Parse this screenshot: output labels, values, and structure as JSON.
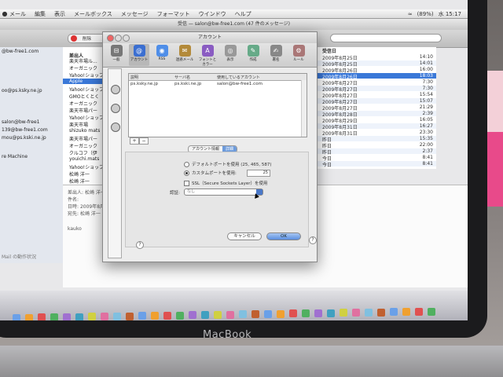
{
  "device": {
    "brand_label": "MacBook"
  },
  "menubar": {
    "items": [
      "メール",
      "編集",
      "表示",
      "メールボックス",
      "メッセージ",
      "フォーマット",
      "ウインドウ",
      "ヘルプ"
    ],
    "battery": "(89%)",
    "clock": "水 15:17"
  },
  "main_window": {
    "title": "受信 — salon@bw-free1.com (47 件のメッセージ)",
    "toolbar": {
      "delete_label": "削除",
      "search_label": "検索"
    }
  },
  "sidebar": {
    "items": [
      "@bw-free1.com",
      "oo@ps.ksky.ne.jp",
      "",
      "",
      "salon@bw-free1",
      "139@bw-free1.com",
      "mou@ps.kski.ne.jp",
      "",
      "re Machine"
    ],
    "footer": "Mail の動作状況"
  },
  "message_list": {
    "header": "差出人",
    "rows": [
      "楽天市場ル...",
      "オーガニック",
      "Yahoo!ショップ",
      "Apple",
      "Yahoo!ショップ",
      "GMOとくとく",
      "オーガニック",
      "楽天市場パー",
      "Yahoo!ショップ",
      "楽天市場",
      "shizuko mats",
      "楽天市場パー",
      "オーガニック",
      "クルコフ（伊",
      "youichi.mats",
      "Yahoo!ショップ",
      "松崎 洋一",
      "松崎 洋一"
    ],
    "selected_index": 3
  },
  "date_list": {
    "header": "受信日",
    "search_label": "検索",
    "rows": [
      {
        "date": "2009年8月25日",
        "time": "14:10"
      },
      {
        "date": "2009年8月25日",
        "time": "14:01"
      },
      {
        "date": "2009年8月26日",
        "time": "16:00"
      },
      {
        "date": "2009年8月26日",
        "time": "18:03"
      },
      {
        "date": "2009年8月27日",
        "time": "7:30"
      },
      {
        "date": "2009年8月27日",
        "time": "7:30"
      },
      {
        "date": "2009年8月27日",
        "time": "15:54"
      },
      {
        "date": "2009年8月27日",
        "time": "15:07"
      },
      {
        "date": "2009年8月27日",
        "time": "21:29"
      },
      {
        "date": "2009年8月28日",
        "time": "2:39"
      },
      {
        "date": "2009年8月29日",
        "time": "16:05"
      },
      {
        "date": "2009年8月31日",
        "time": "16:27"
      },
      {
        "date": "2009年8月31日",
        "time": "23:30"
      },
      {
        "date": "昨日",
        "time": "15:35"
      },
      {
        "date": "昨日",
        "time": "22:00"
      },
      {
        "date": "昨日",
        "time": "2:37"
      },
      {
        "date": "今日",
        "time": "8:41"
      },
      {
        "date": "今日",
        "time": "8:41"
      }
    ],
    "selected_index": 3
  },
  "preview": {
    "from_label": "差出人:",
    "from_value": "松崎 洋一",
    "subject_label": "件名:",
    "date_label": "日時:",
    "date_value": "2009年8月2",
    "to_label": "宛先:",
    "to_value": "松崎 洋一",
    "body": "kauko"
  },
  "accounts_dialog": {
    "title": "アカウント",
    "toolbar": [
      {
        "label": "一般",
        "icon": "switch-icon"
      },
      {
        "label": "アカウント",
        "icon": "at-sign-icon"
      },
      {
        "label": "RSS",
        "icon": "rss-icon"
      },
      {
        "label": "迷惑メール",
        "icon": "junk-mail-icon"
      },
      {
        "label": "フォントとカラー",
        "icon": "fonts-colors-icon"
      },
      {
        "label": "表示",
        "icon": "glasses-icon"
      },
      {
        "label": "作成",
        "icon": "compose-icon"
      },
      {
        "label": "署名",
        "icon": "signature-icon"
      },
      {
        "label": "ルール",
        "icon": "rules-icon"
      }
    ],
    "selected_tool_index": 1,
    "table": {
      "columns": [
        "説明",
        "サーバ名",
        "使用しているアカウント"
      ],
      "rows": [
        [
          "ps.ksky.ne.jp",
          "ps.kski.ne.jp",
          "salon@bw-free1.com"
        ]
      ]
    },
    "segments": [
      "アカウント情報",
      "詳細"
    ],
    "active_segment": 1,
    "radio_default": "デフォルトポートを使用 (25, 465, 587)",
    "radio_custom": "カスタムポートを使用:",
    "custom_port": "25",
    "ssl_label": "SSL（Secure Sockets Layer）を使用",
    "auth_label": "認証:",
    "auth_value": "なし",
    "cancel_label": "キャンセル",
    "ok_label": "OK",
    "help_glyph": "?",
    "plus_glyph": "+",
    "minus_glyph": "−"
  }
}
